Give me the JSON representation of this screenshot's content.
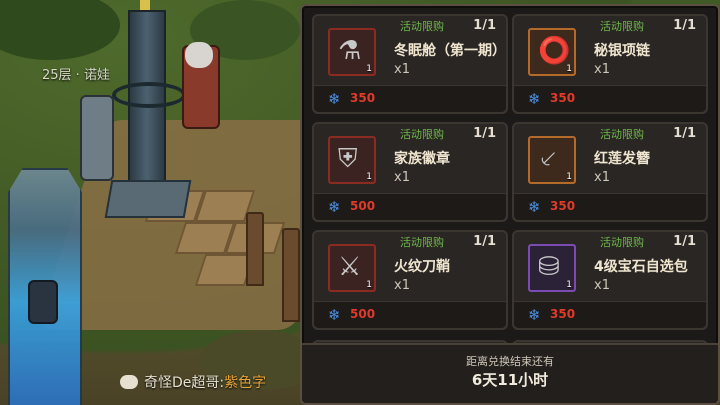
{
  "world": {
    "floor_label": "25层 · 诺娃",
    "chat": {
      "speaker": "奇怪De超哥:",
      "message": "紫色字"
    }
  },
  "shop": {
    "items": [
      {
        "tag": "活动限购",
        "limit": "1/1",
        "name": "冬眠舱（第一期）",
        "qty": "x1",
        "price": "350",
        "icon": "capsule-icon",
        "frame": "red"
      },
      {
        "tag": "活动限购",
        "limit": "1/1",
        "name": "秘银项链",
        "qty": "x1",
        "price": "350",
        "icon": "necklace-icon",
        "frame": "gold"
      },
      {
        "tag": "活动限购",
        "limit": "1/1",
        "name": "家族徽章",
        "qty": "x1",
        "price": "500",
        "icon": "badge-icon",
        "frame": "red"
      },
      {
        "tag": "活动限购",
        "limit": "1/1",
        "name": "红莲发簪",
        "qty": "x1",
        "price": "350",
        "icon": "hairpin-icon",
        "frame": "gold"
      },
      {
        "tag": "活动限购",
        "limit": "1/1",
        "name": "火纹刀鞘",
        "qty": "x1",
        "price": "500",
        "icon": "sheath-icon",
        "frame": "red"
      },
      {
        "tag": "活动限购",
        "limit": "1/1",
        "name": "4级宝石自选包",
        "qty": "x1",
        "price": "350",
        "icon": "gem-chest-icon",
        "frame": "purple"
      }
    ],
    "footer": {
      "label": "距离兑换结束还有",
      "countdown": "6天11小时"
    }
  }
}
